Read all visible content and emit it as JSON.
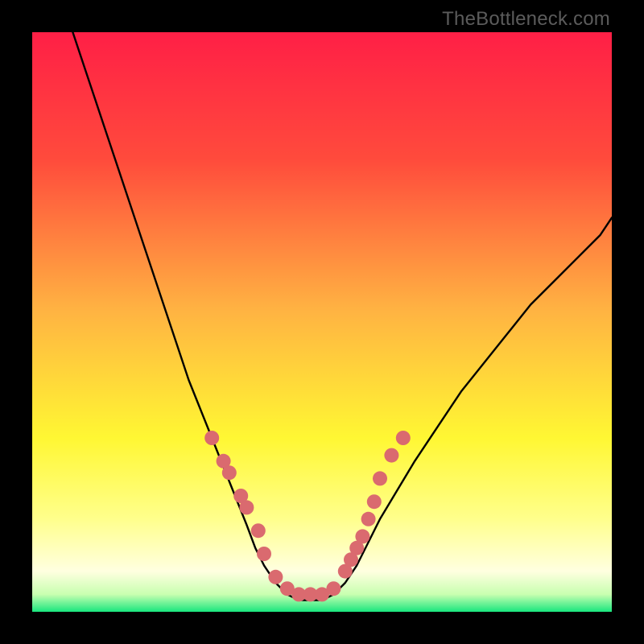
{
  "watermark": {
    "text": "TheBottleneck.com"
  },
  "chart_data": {
    "type": "line",
    "title": "",
    "xlabel": "",
    "ylabel": "",
    "xlim": [
      0,
      100
    ],
    "ylim": [
      0,
      100
    ],
    "grid": false,
    "legend": false,
    "bg_gradient": {
      "stops": [
        {
          "pos": 0,
          "color": "#ff1f46"
        },
        {
          "pos": 22,
          "color": "#ff4b3c"
        },
        {
          "pos": 48,
          "color": "#ffb342"
        },
        {
          "pos": 70,
          "color": "#fff733"
        },
        {
          "pos": 84,
          "color": "#ffff8c"
        },
        {
          "pos": 93,
          "color": "#ffffe0"
        },
        {
          "pos": 97,
          "color": "#c8ffb0"
        },
        {
          "pos": 100,
          "color": "#19e67e"
        }
      ]
    },
    "series": [
      {
        "name": "curve-left",
        "type": "line",
        "stroke": "#000000",
        "x": [
          7,
          9,
          11,
          13,
          15,
          17,
          19,
          21,
          23,
          25,
          27,
          29,
          31,
          33,
          35,
          37,
          38.5,
          40,
          42,
          44
        ],
        "y": [
          100,
          94,
          88,
          82,
          76,
          70,
          64,
          58,
          52,
          46,
          40,
          35,
          30,
          25,
          20,
          15,
          11,
          8,
          5,
          3
        ]
      },
      {
        "name": "curve-bottom",
        "type": "line",
        "stroke": "#000000",
        "x": [
          44,
          46,
          48,
          50,
          52
        ],
        "y": [
          3,
          2,
          2,
          2,
          3
        ]
      },
      {
        "name": "curve-right",
        "type": "line",
        "stroke": "#000000",
        "x": [
          52,
          54,
          56,
          58,
          60,
          63,
          66,
          70,
          74,
          78,
          82,
          86,
          90,
          94,
          98,
          100
        ],
        "y": [
          3,
          5,
          8,
          12,
          16,
          21,
          26,
          32,
          38,
          43,
          48,
          53,
          57,
          61,
          65,
          68
        ]
      },
      {
        "name": "left-dots",
        "type": "scatter",
        "color": "#da6a6f",
        "r": 9,
        "x": [
          31,
          33,
          34,
          36,
          37,
          39,
          40,
          42,
          44,
          46,
          48,
          50
        ],
        "y": [
          30,
          26,
          24,
          20,
          18,
          14,
          10,
          6,
          4,
          3,
          3,
          3
        ]
      },
      {
        "name": "right-dots",
        "type": "scatter",
        "color": "#da6a6f",
        "r": 9,
        "x": [
          52,
          54,
          55,
          56,
          57,
          58,
          59,
          60,
          62,
          64
        ],
        "y": [
          4,
          7,
          9,
          11,
          13,
          16,
          19,
          23,
          27,
          30
        ]
      }
    ]
  }
}
